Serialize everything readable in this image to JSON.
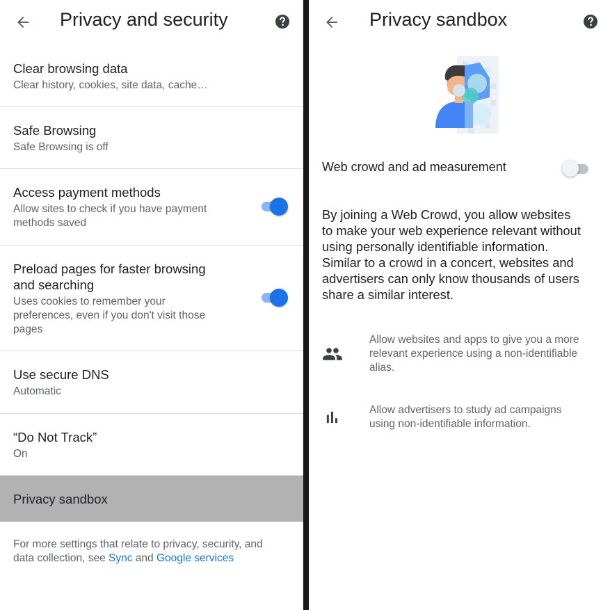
{
  "left": {
    "title": "Privacy and security",
    "items": [
      {
        "title": "Clear browsing data",
        "subtitle": "Clear history, cookies, site data, cache…"
      },
      {
        "title": "Safe Browsing",
        "subtitle": "Safe Browsing is off"
      },
      {
        "title": "Access payment methods",
        "subtitle_lines": [
          "Allow sites to check if you have payment",
          "methods saved"
        ],
        "toggle": true
      },
      {
        "title_lines": [
          "Preload pages for faster browsing",
          "and searching"
        ],
        "subtitle_lines": [
          "Uses cookies to remember your",
          "preferences, even if you don't visit those",
          "pages"
        ],
        "toggle": true
      },
      {
        "title": "Use secure DNS",
        "subtitle": "Automatic"
      },
      {
        "title": "“Do Not Track”",
        "subtitle": "On"
      },
      {
        "title": "Privacy sandbox"
      }
    ],
    "footer": {
      "line1": "For more settings that relate to privacy, security, and",
      "line2_prefix": "data collection, see ",
      "sync_link": "Sync",
      "and": " and ",
      "google_link": "Google services"
    }
  },
  "right": {
    "title": "Privacy sandbox",
    "setting_label": "Web crowd and ad measurement",
    "setting_on": false,
    "description_lines": [
      "By joining a Web Crowd, you allow websites",
      "to make your web experience relevant without",
      "using personally identifiable information.",
      "Similar to a crowd in a concert, websites and",
      "advertisers can only know thousands of users",
      "share a similar interest."
    ],
    "features": [
      {
        "icon": "people-icon",
        "lines": [
          "Allow websites and apps to give you a more",
          "relevant experience using a non-identifiable",
          "alias."
        ]
      },
      {
        "icon": "bar-chart-icon",
        "lines": [
          "Allow advertisers to study ad campaigns",
          "using non-identifiable information."
        ]
      }
    ]
  },
  "colors": {
    "accent": "#1a73e8",
    "selected_row": "#b2b2b2",
    "divider": "#1a1a1a"
  }
}
